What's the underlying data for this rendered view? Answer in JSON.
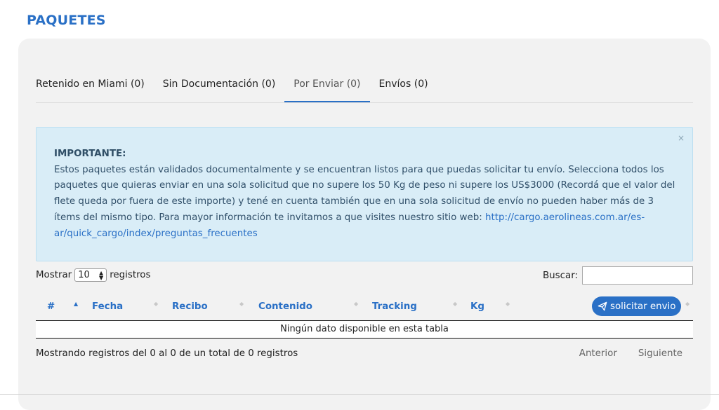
{
  "page": {
    "title": "PAQUETES"
  },
  "tabs": [
    {
      "label": "Retenido en Miami (0)"
    },
    {
      "label": "Sin Documentación (0)"
    },
    {
      "label": "Por Enviar (0)"
    },
    {
      "label": "Envíos (0)"
    }
  ],
  "alert": {
    "close": "×",
    "heading": "IMPORTANTE:",
    "body": "Estos paquetes están validados documentalmente y se encuentran listos para que puedas solicitar tu envío. Selecciona todos los paquetes que quieras enviar en una sola solicitud que no supere los 50 Kg de peso ni supere los US$3000 (Recordá que el valor del flete queda por fuera de este importe) y tené en cuenta también que en una sola solicitud de envío no pueden haber más de 3 ítems del mismo tipo. Para mayor información te invitamos a que visites nuestro sitio web: ",
    "link": "http://cargo.aerolineas.com.ar/es-ar/quick_cargo/index/preguntas_frecuentes"
  },
  "length_control": {
    "prefix": "Mostrar",
    "value": "10",
    "suffix": "registros"
  },
  "search": {
    "label": "Buscar:",
    "value": ""
  },
  "table": {
    "columns": [
      "#",
      "Fecha",
      "Recibo",
      "Contenido",
      "Tracking",
      "Kg"
    ],
    "action_button": "solicitar envio",
    "empty_message": "Ningún dato disponible en esta tabla"
  },
  "footer": {
    "info": "Mostrando registros del 0 al 0 de un total de 0 registros",
    "prev": "Anterior",
    "next": "Siguiente"
  },
  "colors": {
    "accent": "#2a70c6",
    "alert_bg": "#d9edf7",
    "card_bg": "#f2f2f2"
  }
}
